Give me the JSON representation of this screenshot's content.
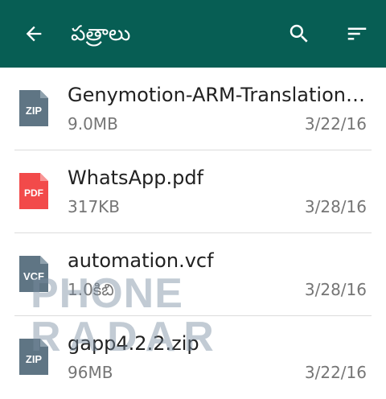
{
  "header": {
    "title": "పత్రాలు",
    "bg_color": "#075e54"
  },
  "icons": {
    "back": "arrow-back-icon",
    "search": "search-icon",
    "sort": "sort-icon"
  },
  "files": [
    {
      "name": "Genymotion-ARM-Translation…",
      "size": "9.0MB",
      "date": "3/22/16",
      "type": "ZIP",
      "color": "#5f7584"
    },
    {
      "name": "WhatsApp.pdf",
      "size": "317KB",
      "date": "3/28/16",
      "type": "PDF",
      "color": "#f24a4a"
    },
    {
      "name": "automation.vcf",
      "size": "1.0కిబి",
      "date": "3/28/16",
      "type": "VCF",
      "color": "#5f7584"
    },
    {
      "name": "gapp4.2.2.zip",
      "size": "96MB",
      "date": "3/22/16",
      "type": "ZIP",
      "color": "#5f7584"
    }
  ],
  "watermark": {
    "line1": "PHONE",
    "line2": "RADAR"
  }
}
